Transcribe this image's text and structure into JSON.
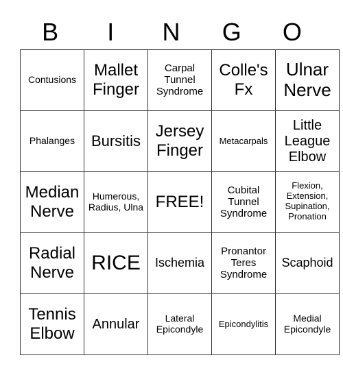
{
  "header": {
    "letters": [
      "B",
      "I",
      "N",
      "G",
      "O"
    ]
  },
  "board": {
    "rows": [
      [
        "Contusions",
        "Mallet Finger",
        "Carpal Tunnel Syndrome",
        "Colle's Fx",
        "Ulnar Nerve"
      ],
      [
        "Phalanges",
        "Bursitis",
        "Jersey Finger",
        "Metacarpals",
        "Little League Elbow"
      ],
      [
        "Median Nerve",
        "Humerous, Radius, Ulna",
        "FREE!",
        "Cubital Tunnel Syndrome",
        "Flexion, Extension, Supination, Pronation"
      ],
      [
        "Radial Nerve",
        "RICE",
        "Ischemia",
        "Pronantor Teres Syndrome",
        "Scaphoid"
      ],
      [
        "Tennis Elbow",
        "Annular",
        "Lateral Epicondyle",
        "Epicondylitis",
        "Medial Epicondyle"
      ]
    ]
  }
}
